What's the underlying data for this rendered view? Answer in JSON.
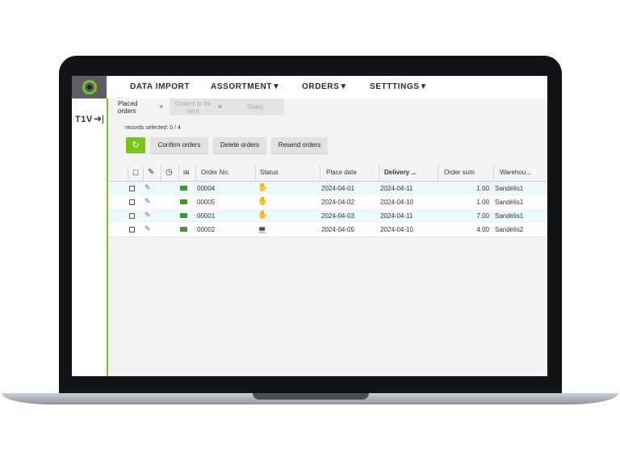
{
  "nav": {
    "data_import": "DATA IMPORT",
    "assortment": "ASSORTMENT▼",
    "orders": "ORDERS▼",
    "settings": "SETTTINGS▼"
  },
  "brand": {
    "text": "T1V",
    "arrow": "➜|"
  },
  "tabs": [
    {
      "label": "Placed orders",
      "close": "×"
    },
    {
      "label": "Orders to be sent",
      "close": "×"
    },
    {
      "label": "Today"
    }
  ],
  "records_selected": "records selected: 0 / 4",
  "toolbar": {
    "refresh_icon": "↻",
    "confirm": "Confirm orders",
    "delete": "Delete orders",
    "resend": "Resend orders"
  },
  "table": {
    "headers": {
      "check": "☐",
      "edit": "✎",
      "clock": "◷",
      "mail": "✉",
      "order_no": "Order No.",
      "status": "Status",
      "place_date": "Place date",
      "delivery": "Delivery ...",
      "order_sum": "Order sum",
      "warehouse": "Warehou..."
    },
    "rows": [
      {
        "order_no": "00004",
        "status_icon": "hand-icon",
        "place_date": "2024-04-01",
        "delivery": "2024-04-11",
        "sum": "1.00",
        "warehouse": "Sandėlis1"
      },
      {
        "order_no": "00005",
        "status_icon": "hand-icon",
        "place_date": "2024-04-02",
        "delivery": "2024-04-10",
        "sum": "1.00",
        "warehouse": "Sandėlis1"
      },
      {
        "order_no": "00001",
        "status_icon": "hand-icon",
        "place_date": "2024-04-03",
        "delivery": "2024-04-11",
        "sum": "7.00",
        "warehouse": "Sandėlis1"
      },
      {
        "order_no": "00002",
        "status_icon": "laptop-icon",
        "place_date": "2024-04-05",
        "delivery": "2024-04-10",
        "sum": "4.00",
        "warehouse": "Sandėlis2"
      }
    ]
  },
  "colors": {
    "accent": "#7bc21a",
    "row_highlight": "#eef7f9",
    "edit_icon": "#4a62c8",
    "mail_icon": "#3a9a2e"
  }
}
